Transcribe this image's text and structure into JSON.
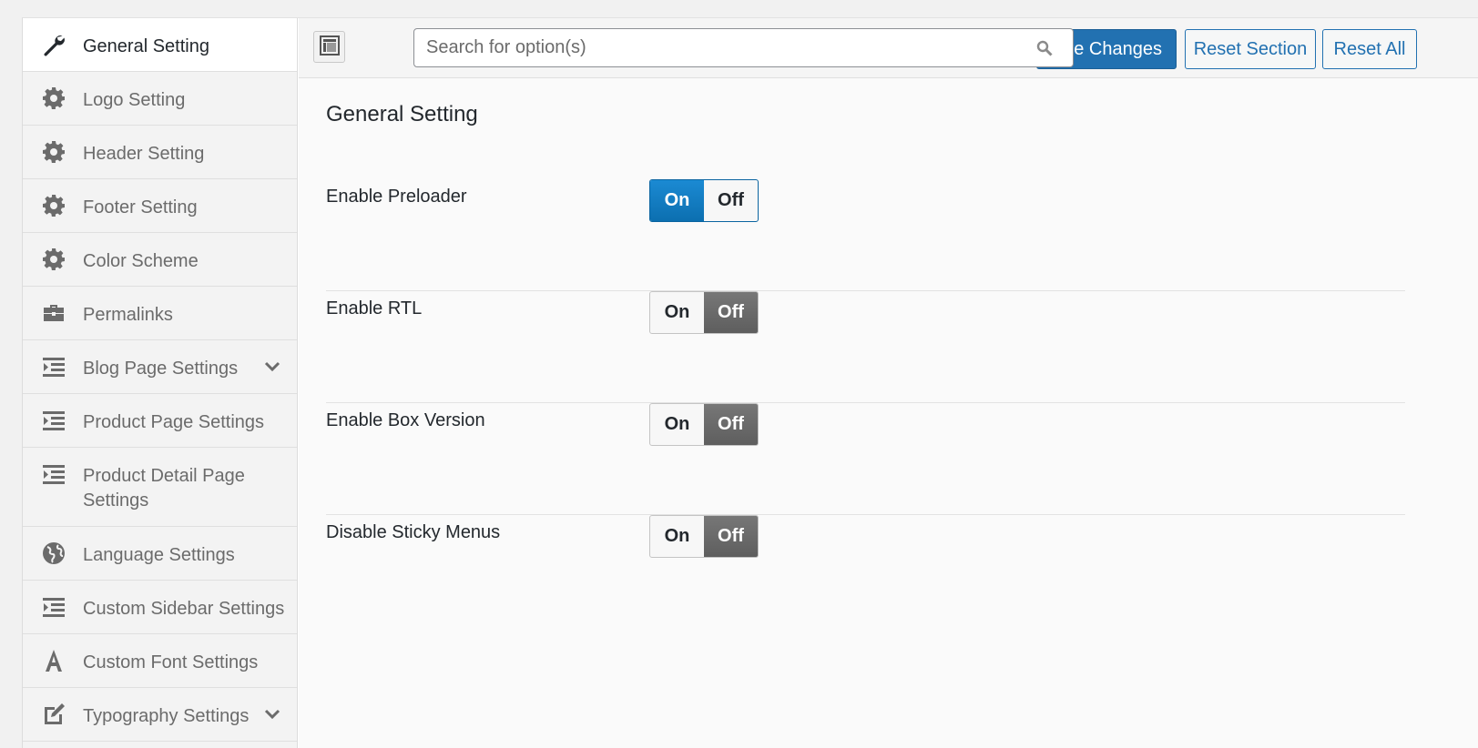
{
  "sidebar": {
    "items": [
      {
        "label": "General Setting",
        "icon": "wrench-icon",
        "active": true
      },
      {
        "label": "Logo Setting",
        "icon": "gear-icon"
      },
      {
        "label": "Header Setting",
        "icon": "gear-icon"
      },
      {
        "label": "Footer Setting",
        "icon": "gear-icon"
      },
      {
        "label": "Color Scheme",
        "icon": "gear-icon"
      },
      {
        "label": "Permalinks",
        "icon": "briefcase-icon"
      },
      {
        "label": "Blog Page Settings",
        "icon": "indent-list-icon",
        "has_children": true
      },
      {
        "label": "Product Page Settings",
        "icon": "indent-list-icon"
      },
      {
        "label": "Product Detail Page Settings",
        "icon": "indent-list-icon"
      },
      {
        "label": "Language Settings",
        "icon": "globe-icon"
      },
      {
        "label": "Custom Sidebar Settings",
        "icon": "indent-list-icon"
      },
      {
        "label": "Custom Font Settings",
        "icon": "font-a-icon"
      },
      {
        "label": "Typography Settings",
        "icon": "edit-square-icon",
        "has_children": true
      }
    ]
  },
  "toolbar": {
    "search_placeholder": "Search for option(s)",
    "save_label": "ave Changes",
    "reset_section_label": "Reset Section",
    "reset_all_label": "Reset All"
  },
  "section": {
    "title": "General Setting",
    "options": [
      {
        "label": "Enable Preloader",
        "on_label": "On",
        "off_label": "Off",
        "value": "on"
      },
      {
        "label": "Enable RTL",
        "on_label": "On",
        "off_label": "Off",
        "value": "off"
      },
      {
        "label": "Enable Box Version",
        "on_label": "On",
        "off_label": "Off",
        "value": "off"
      },
      {
        "label": "Disable Sticky Menus",
        "on_label": "On",
        "off_label": "Off",
        "value": "off"
      }
    ]
  },
  "colors": {
    "primary": "#2271b1",
    "switch_on": "#0c6fb0",
    "switch_off": "#666666"
  }
}
